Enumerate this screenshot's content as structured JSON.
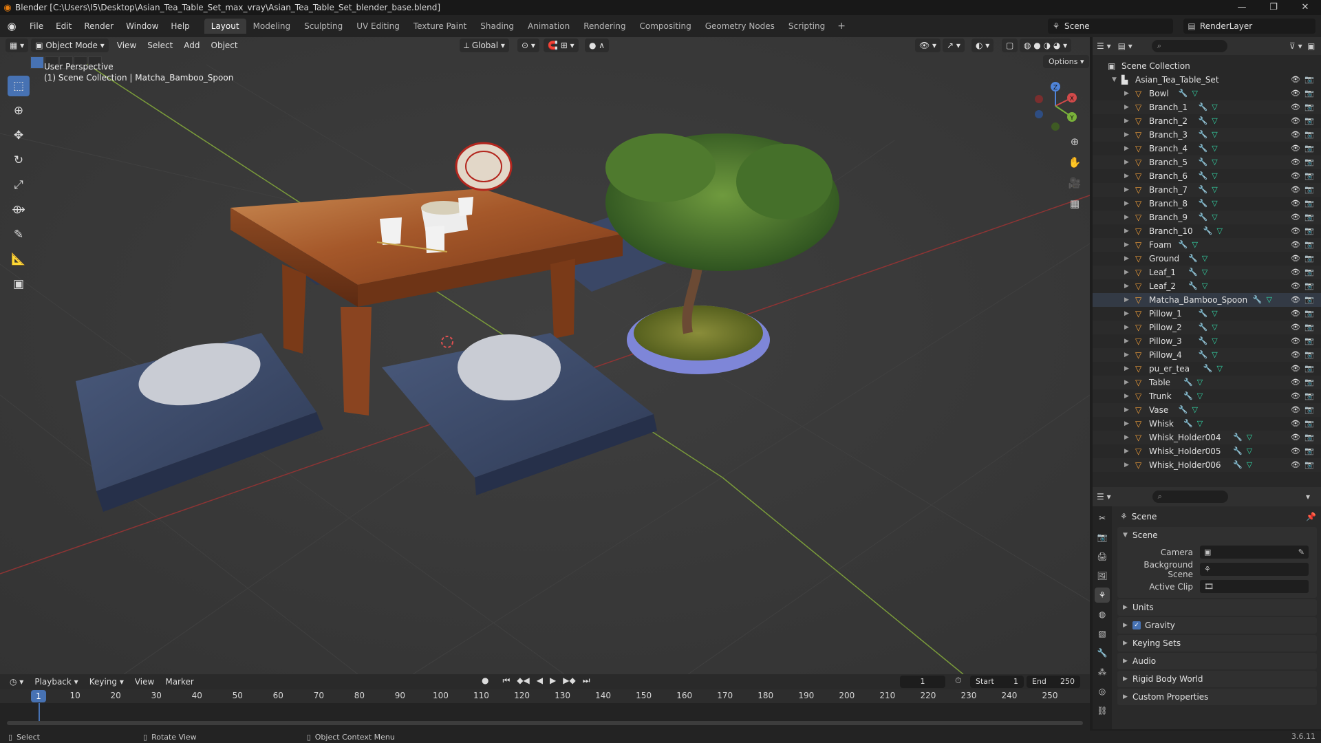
{
  "window": {
    "title": "Blender [C:\\Users\\I5\\Desktop\\Asian_Tea_Table_Set_max_vray\\Asian_Tea_Table_Set_blender_base.blend]",
    "minimize": "—",
    "maximize": "❐",
    "close": "✕"
  },
  "menubar": {
    "items": [
      "File",
      "Edit",
      "Render",
      "Window",
      "Help"
    ]
  },
  "workspaces": {
    "tabs": [
      "Layout",
      "Modeling",
      "Sculpting",
      "UV Editing",
      "Texture Paint",
      "Shading",
      "Animation",
      "Rendering",
      "Compositing",
      "Geometry Nodes",
      "Scripting"
    ],
    "active": "Layout",
    "add": "+"
  },
  "scene_selector": {
    "value": "Scene"
  },
  "view_layer": {
    "value": "RenderLayer"
  },
  "viewport": {
    "mode": "Object Mode",
    "menus": [
      "View",
      "Select",
      "Add",
      "Object"
    ],
    "transform_orientation": "Global",
    "options_label": "Options",
    "overlay_line1": "User Perspective",
    "overlay_line2": "(1) Scene Collection | Matcha_Bamboo_Spoon",
    "gizmo": {
      "x": "X",
      "y": "Y",
      "z": "Z"
    }
  },
  "outliner": {
    "search_placeholder": "",
    "root": "Scene Collection",
    "collection": "Asian_Tea_Table_Set",
    "objects": [
      "Bowl",
      "Branch_1",
      "Branch_2",
      "Branch_3",
      "Branch_4",
      "Branch_5",
      "Branch_6",
      "Branch_7",
      "Branch_8",
      "Branch_9",
      "Branch_10",
      "Foam",
      "Ground",
      "Leaf_1",
      "Leaf_2",
      "Matcha_Bamboo_Spoon",
      "Pillow_1",
      "Pillow_2",
      "Pillow_3",
      "Pillow_4",
      "pu_er_tea",
      "Table",
      "Trunk",
      "Vase",
      "Whisk",
      "Whisk_Holder004",
      "Whisk_Holder005",
      "Whisk_Holder006"
    ],
    "active_object": "Matcha_Bamboo_Spoon"
  },
  "properties": {
    "context_title": "Scene",
    "scene_panel": {
      "title": "Scene",
      "camera_label": "Camera",
      "background_scene_label": "Background Scene",
      "active_clip_label": "Active Clip"
    },
    "panels": [
      "Units",
      "Gravity",
      "Keying Sets",
      "Audio",
      "Rigid Body World",
      "Custom Properties"
    ],
    "gravity_enabled": true
  },
  "timeline": {
    "menus": [
      "Playback",
      "Keying",
      "View",
      "Marker"
    ],
    "current_frame": "1",
    "start_label": "Start",
    "start": "1",
    "end_label": "End",
    "end": "250",
    "ticks": [
      "1",
      "10",
      "20",
      "30",
      "40",
      "50",
      "60",
      "70",
      "80",
      "90",
      "100",
      "110",
      "120",
      "130",
      "140",
      "150",
      "160",
      "170",
      "180",
      "190",
      "200",
      "210",
      "220",
      "230",
      "240",
      "250"
    ]
  },
  "statusbar": {
    "select": "Select",
    "rotate_view": "Rotate View",
    "context_menu": "Object Context Menu",
    "version": "3.6.11"
  },
  "colors": {
    "accent": "#4772b3",
    "object_icon": "#f5a13a",
    "modifier_icon": "#6db3ea",
    "mesh_icon": "#33d9a8"
  }
}
